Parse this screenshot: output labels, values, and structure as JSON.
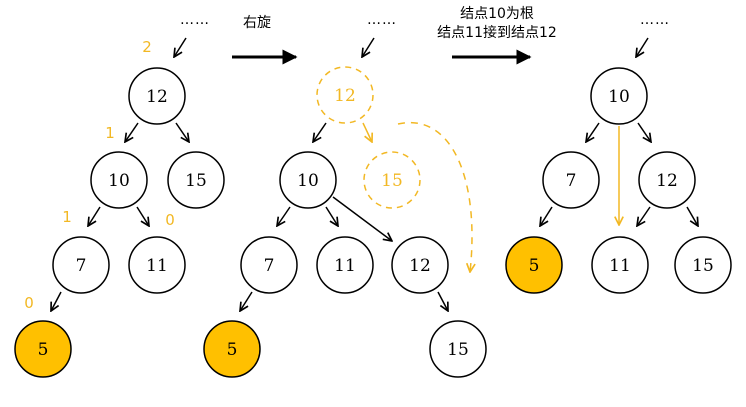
{
  "colors": {
    "node_stroke": "#000000",
    "node_fill": "#ffffff",
    "highlight_fill": "#FFC000",
    "accent": "#F2B824",
    "arrow": "#000000"
  },
  "labels": {
    "rotate_right": "右旋",
    "step2_line1": "结点10为根",
    "step2_line2": "结点11接到结点12",
    "ellipsis": "……"
  },
  "panels": [
    {
      "id": "before",
      "nodes": [
        {
          "key": "12",
          "fill": "normal",
          "bf": "2"
        },
        {
          "key": "10",
          "fill": "normal",
          "bf": "1"
        },
        {
          "key": "15",
          "fill": "normal",
          "bf": ""
        },
        {
          "key": "7",
          "fill": "normal",
          "bf": "1"
        },
        {
          "key": "11",
          "fill": "normal",
          "bf": "0"
        },
        {
          "key": "5",
          "fill": "highlight",
          "bf": "0"
        }
      ]
    },
    {
      "id": "rotating",
      "nodes": [
        {
          "key": "12",
          "fill": "ghost"
        },
        {
          "key": "15",
          "fill": "ghost"
        },
        {
          "key": "10",
          "fill": "normal"
        },
        {
          "key": "7",
          "fill": "normal"
        },
        {
          "key": "11",
          "fill": "normal"
        },
        {
          "key": "12",
          "fill": "normal"
        },
        {
          "key": "5",
          "fill": "highlight"
        },
        {
          "key": "15",
          "fill": "normal"
        }
      ]
    },
    {
      "id": "after",
      "nodes": [
        {
          "key": "10",
          "fill": "normal"
        },
        {
          "key": "7",
          "fill": "normal"
        },
        {
          "key": "12",
          "fill": "normal"
        },
        {
          "key": "5",
          "fill": "highlight"
        },
        {
          "key": "11",
          "fill": "normal"
        },
        {
          "key": "15",
          "fill": "normal"
        }
      ]
    }
  ]
}
